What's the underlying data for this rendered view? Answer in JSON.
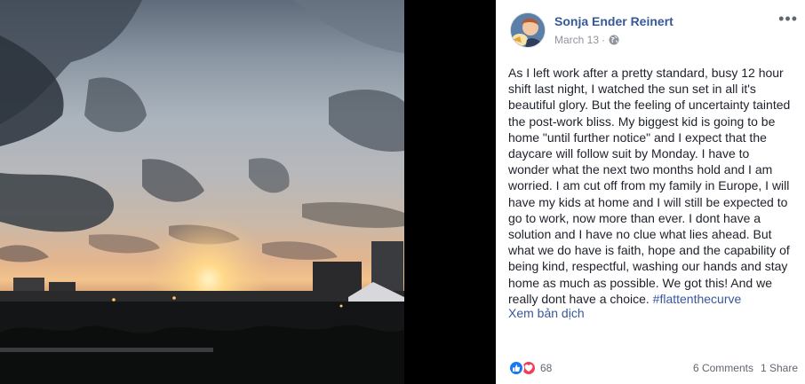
{
  "post": {
    "author": "Sonja Ender Reinert",
    "date": "March 13",
    "separator": "·",
    "body": "As I left work after a pretty standard, busy 12 hour shift last night, I watched the sun set in all it's beautiful glory. But the feeling of uncertainty tainted the post-work bliss. My biggest kid is going to be home \"until further notice\" and I expect that the daycare will follow suit by Monday. I have to wonder what the next two months hold and I am worried. I am cut off from my family in Europe, I will have my kids at home and I will still be expected to go to work, now more than ever. I dont have a solution and I have no clue what lies ahead. But what we do have is faith, hope and the capability of being kind, respectful, washing our hands and stay home as much as possible. We got this! And we really dont have a choice. ",
    "hashtag": "#flattenthecurve",
    "translate_label": "Xem bản dịch",
    "more_label": "•••",
    "privacy_icon": "globe-icon"
  },
  "footer": {
    "reaction_count": "68",
    "reaction_icons": [
      "like-icon",
      "love-icon"
    ],
    "comments_label": "6 Comments",
    "shares_label": "1 Share"
  },
  "colors": {
    "link_blue": "#365899",
    "meta_gray": "#90949c",
    "text": "#1d2129",
    "like_blue": "#1877f2",
    "love_red": "#f33e58"
  }
}
